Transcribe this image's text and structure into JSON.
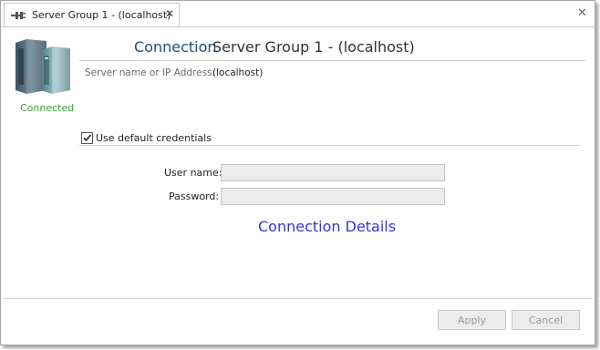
{
  "tab": {
    "title": "Server Group 1 - (localhost)",
    "close": "✕"
  },
  "window": {
    "close": "✕"
  },
  "status": {
    "text": "Connected",
    "color": "#3aa23a"
  },
  "connection": {
    "label": "Connection",
    "value": "Server Group 1 - (localhost)",
    "server_label": "Server name or IP Address:",
    "server_value": "(localhost)"
  },
  "credentials": {
    "use_default_label": "Use default credentials",
    "use_default_checked": true,
    "username_label": "User name:",
    "username_value": "",
    "password_label": "Password:",
    "password_value": ""
  },
  "details_link": "Connection Details",
  "buttons": {
    "apply": "Apply",
    "cancel": "Cancel"
  },
  "icons": {
    "tab": "plug-connection-icon",
    "server": "server-computers-icon",
    "checkbox": "checkmark-icon"
  }
}
